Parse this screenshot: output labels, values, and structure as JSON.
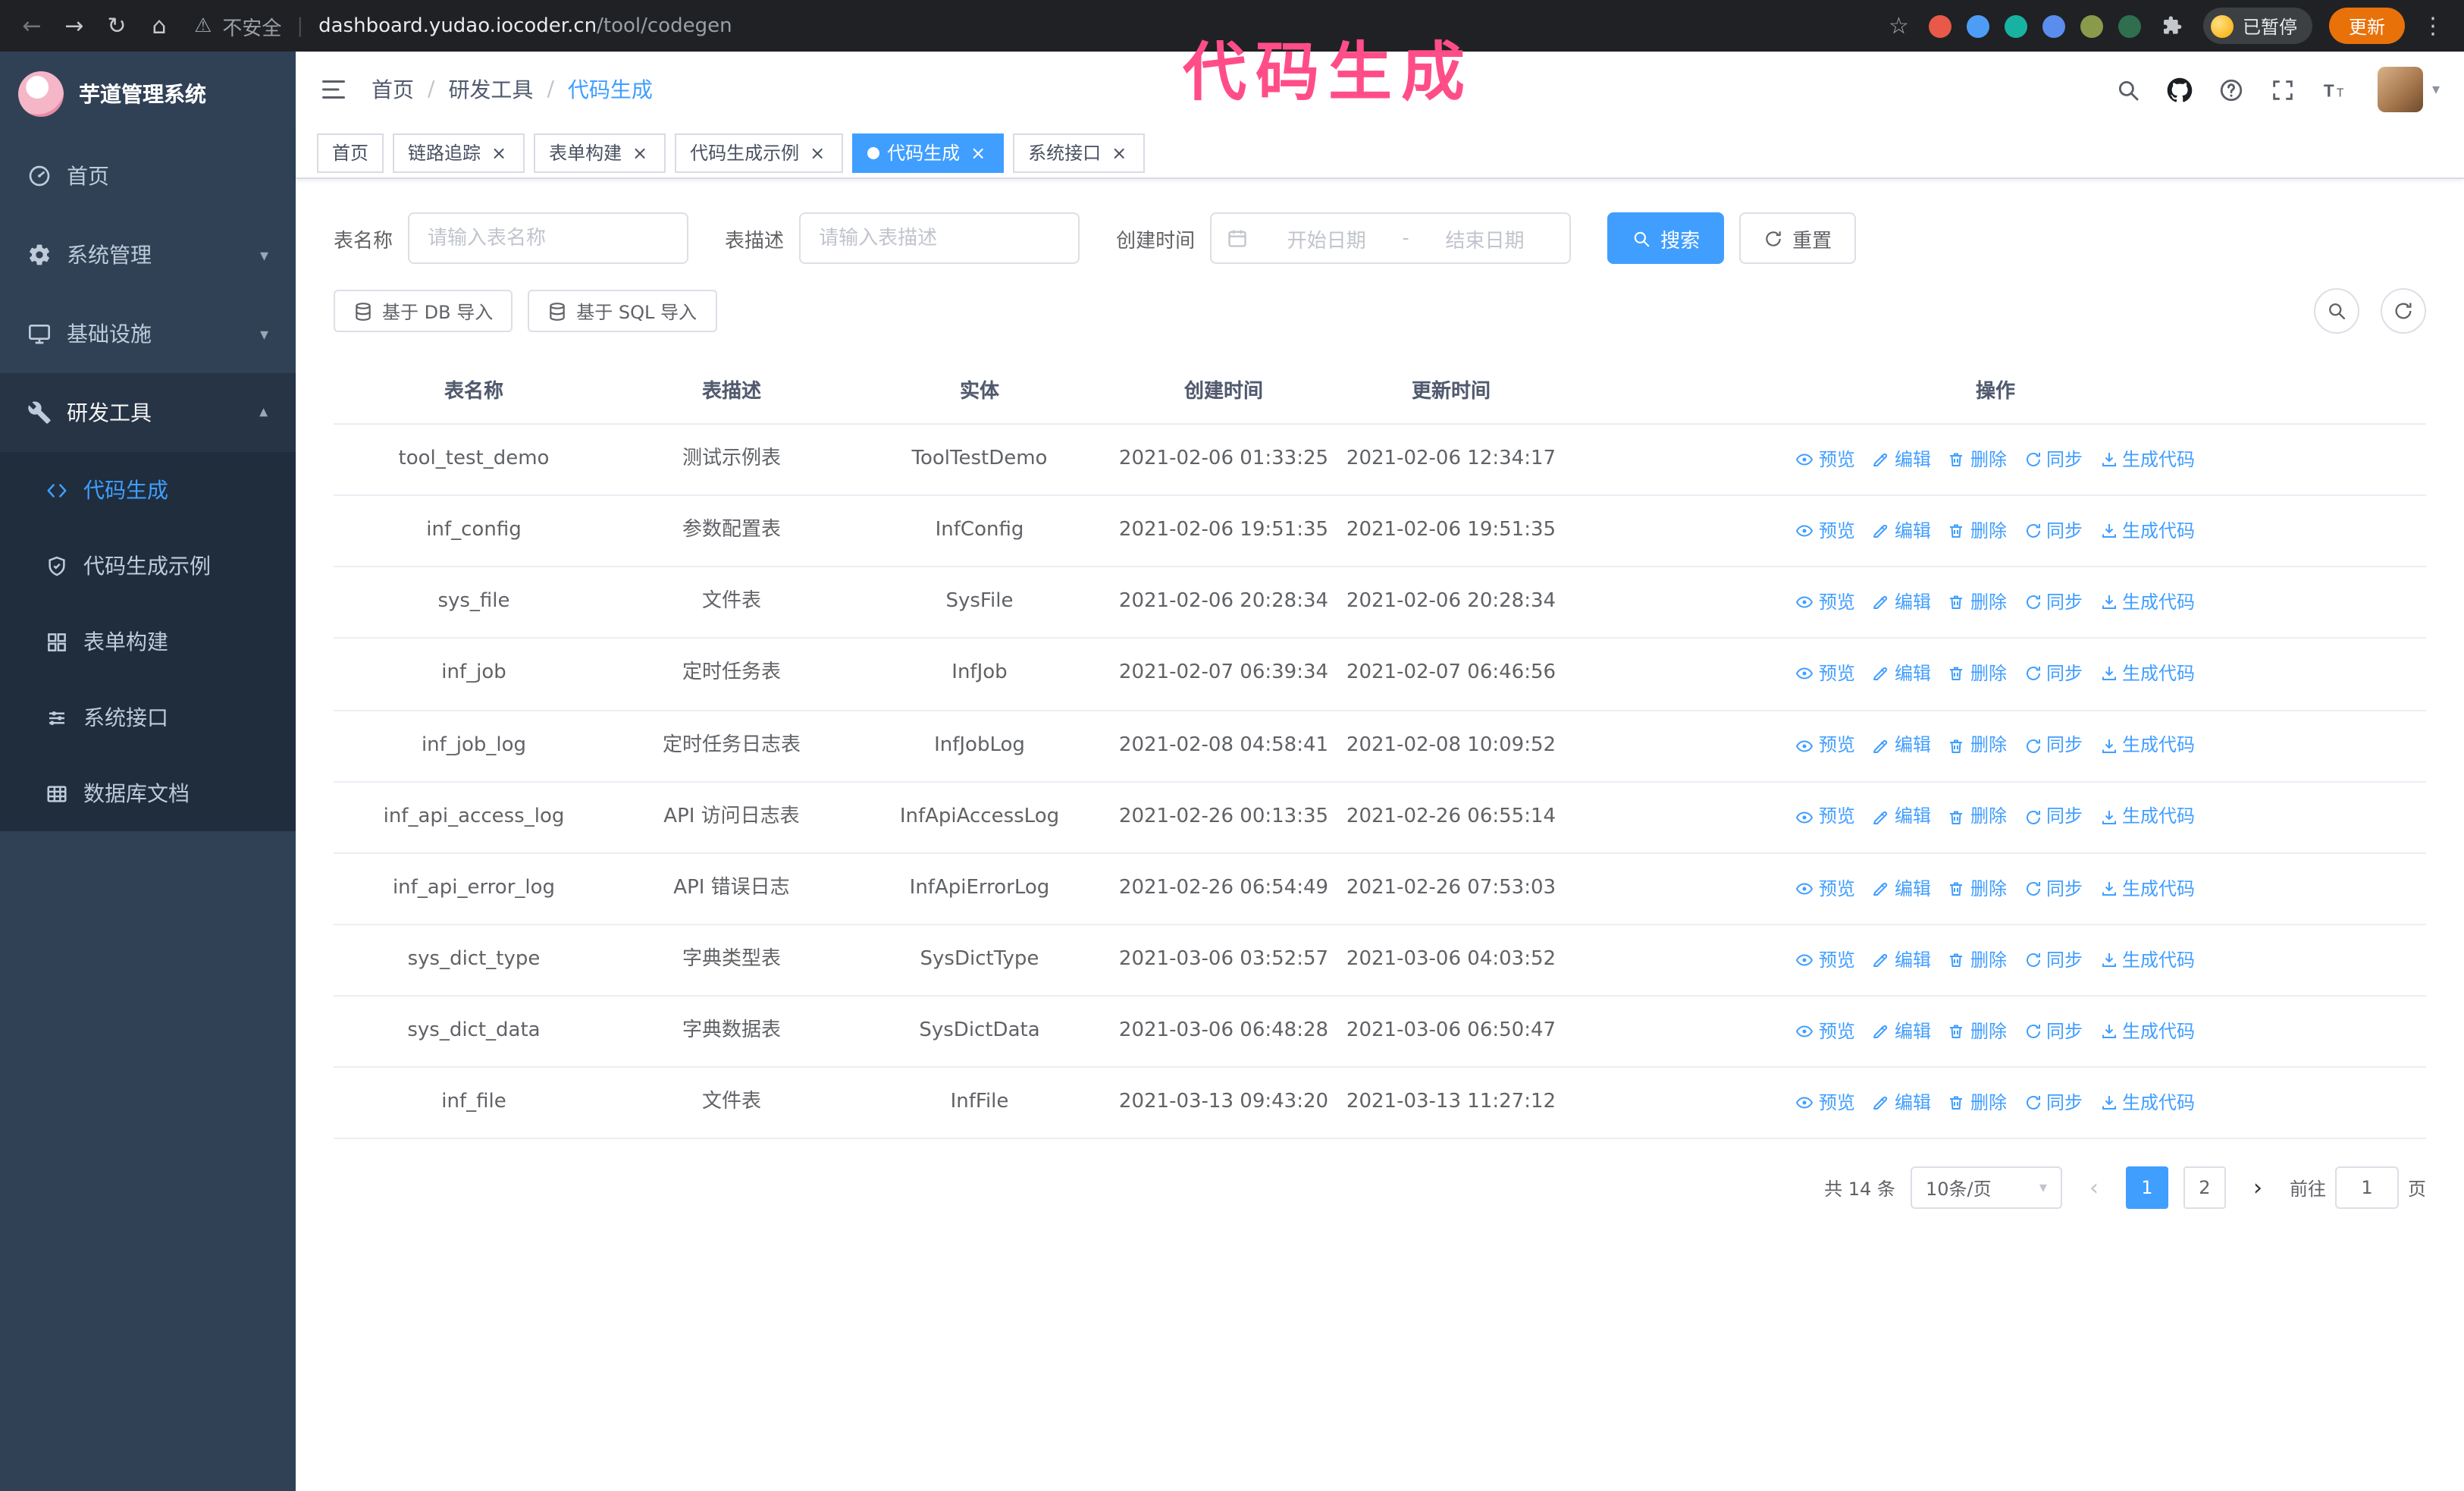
{
  "theme": {
    "primary": "#409eff",
    "sidebar_bg": "#304156",
    "submenu_bg": "#1f2d3d",
    "annotation_color": "#ff4d88"
  },
  "annotation": {
    "text": "代码生成"
  },
  "browser": {
    "security_warning": "不安全",
    "url_host": "dashboard.yudao.iocoder.cn",
    "url_path": "/tool/codegen",
    "paused_chip": "已暂停",
    "update_button": "更新"
  },
  "icons": {
    "back": "←",
    "forward": "→",
    "reload": "↻",
    "home": "⌂",
    "warning": "⚠",
    "pipe": "|",
    "star": "☆",
    "kebab": "⋮",
    "caret": "▾",
    "close": "×",
    "slash": "/",
    "prev": "‹",
    "next": "›"
  },
  "sidebar": {
    "logo_title": "芋道管理系统",
    "items": [
      {
        "label": "首页",
        "expanded": false
      },
      {
        "label": "系统管理",
        "expanded": false
      },
      {
        "label": "基础设施",
        "expanded": false
      },
      {
        "label": "研发工具",
        "expanded": true
      }
    ],
    "submenu": [
      {
        "label": "代码生成",
        "active": true
      },
      {
        "label": "代码生成示例",
        "active": false
      },
      {
        "label": "表单构建",
        "active": false
      },
      {
        "label": "系统接口",
        "active": false
      },
      {
        "label": "数据库文档",
        "active": false
      }
    ]
  },
  "header": {
    "breadcrumb": [
      "首页",
      "研发工具",
      "代码生成"
    ]
  },
  "tabs": [
    {
      "label": "首页",
      "closable": false,
      "active": false
    },
    {
      "label": "链路追踪",
      "closable": true,
      "active": false
    },
    {
      "label": "表单构建",
      "closable": true,
      "active": false
    },
    {
      "label": "代码生成示例",
      "closable": true,
      "active": false
    },
    {
      "label": "代码生成",
      "closable": true,
      "active": true
    },
    {
      "label": "系统接口",
      "closable": true,
      "active": false
    }
  ],
  "filters": {
    "table_name_label": "表名称",
    "table_name_placeholder": "请输入表名称",
    "table_desc_label": "表描述",
    "table_desc_placeholder": "请输入表描述",
    "create_time_label": "创建时间",
    "date_start_placeholder": "开始日期",
    "date_separator": "-",
    "date_end_placeholder": "结束日期",
    "search_button": "搜索",
    "reset_button": "重置"
  },
  "toolbar": {
    "import_db": "基于 DB 导入",
    "import_sql": "基于 SQL 导入"
  },
  "table": {
    "columns": [
      "表名称",
      "表描述",
      "实体",
      "创建时间",
      "更新时间",
      "操作"
    ],
    "actions": [
      "预览",
      "编辑",
      "删除",
      "同步",
      "生成代码"
    ],
    "rows": [
      {
        "name": "tool_test_demo",
        "desc": "测试示例表",
        "entity": "ToolTestDemo",
        "created": "2021-02-06 01:33:25",
        "updated": "2021-02-06 12:34:17"
      },
      {
        "name": "inf_config",
        "desc": "参数配置表",
        "entity": "InfConfig",
        "created": "2021-02-06 19:51:35",
        "updated": "2021-02-06 19:51:35"
      },
      {
        "name": "sys_file",
        "desc": "文件表",
        "entity": "SysFile",
        "created": "2021-02-06 20:28:34",
        "updated": "2021-02-06 20:28:34"
      },
      {
        "name": "inf_job",
        "desc": "定时任务表",
        "entity": "InfJob",
        "created": "2021-02-07 06:39:34",
        "updated": "2021-02-07 06:46:56"
      },
      {
        "name": "inf_job_log",
        "desc": "定时任务日志表",
        "entity": "InfJobLog",
        "created": "2021-02-08 04:58:41",
        "updated": "2021-02-08 10:09:52"
      },
      {
        "name": "inf_api_access_log",
        "desc": "API 访问日志表",
        "entity": "InfApiAccessLog",
        "created": "2021-02-26 00:13:35",
        "updated": "2021-02-26 06:55:14"
      },
      {
        "name": "inf_api_error_log",
        "desc": "API 错误日志",
        "entity": "InfApiErrorLog",
        "created": "2021-02-26 06:54:49",
        "updated": "2021-02-26 07:53:03"
      },
      {
        "name": "sys_dict_type",
        "desc": "字典类型表",
        "entity": "SysDictType",
        "created": "2021-03-06 03:52:57",
        "updated": "2021-03-06 04:03:52"
      },
      {
        "name": "sys_dict_data",
        "desc": "字典数据表",
        "entity": "SysDictData",
        "created": "2021-03-06 06:48:28",
        "updated": "2021-03-06 06:50:47"
      },
      {
        "name": "inf_file",
        "desc": "文件表",
        "entity": "InfFile",
        "created": "2021-03-13 09:43:20",
        "updated": "2021-03-13 11:27:12"
      }
    ]
  },
  "pagination": {
    "total": "共 14 条",
    "page_size": "10条/页",
    "pages": [
      "1",
      "2"
    ],
    "active_page": "1",
    "goto_label": "前往",
    "goto_value": "1",
    "page_unit": "页"
  }
}
